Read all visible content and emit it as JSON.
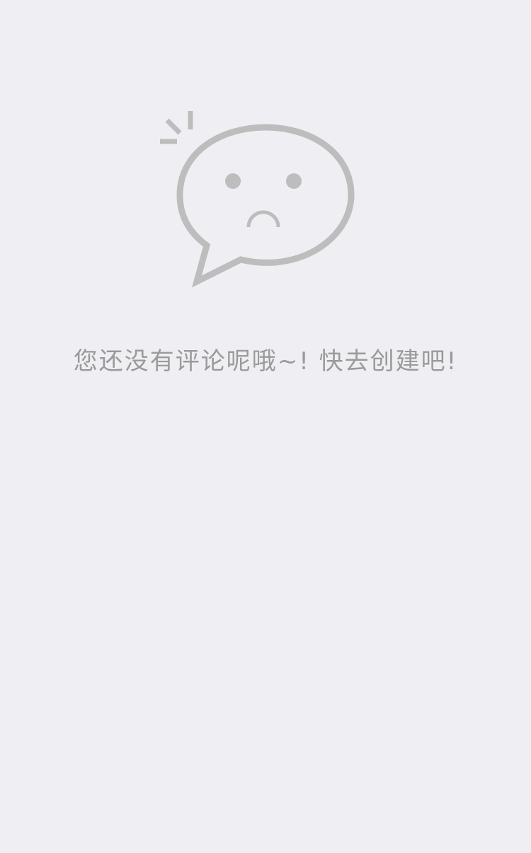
{
  "empty_state": {
    "icon": "sad-speech-bubble-icon",
    "message": "您还没有评论呢哦~! 快去创建吧!",
    "colors": {
      "background": "#efeff3",
      "icon": "#bdbdbd",
      "text": "#9a9a9a"
    }
  }
}
